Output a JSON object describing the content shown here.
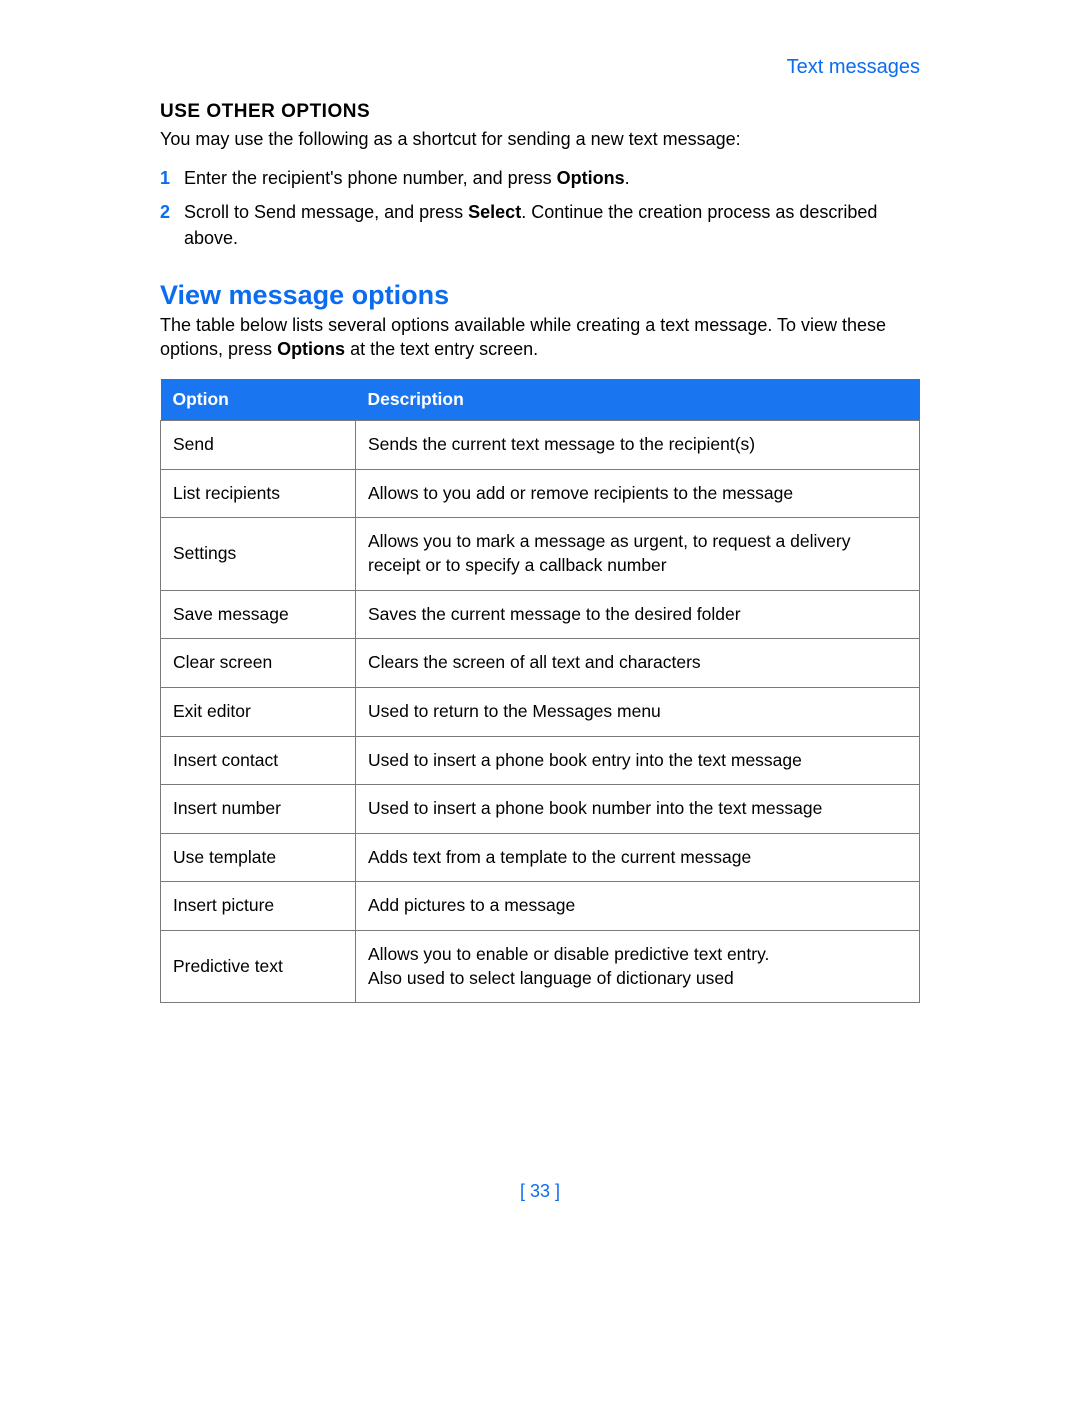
{
  "header": {
    "breadcrumb": "Text messages"
  },
  "use_other_options": {
    "heading": "USE OTHER OPTIONS",
    "intro": "You may use the following as a shortcut for sending a new text message:",
    "steps": [
      {
        "num": "1",
        "text_before": "Enter the recipient's phone number, and press ",
        "bold": "Options",
        "text_after": "."
      },
      {
        "num": "2",
        "text_before": "Scroll to Send message, and press ",
        "bold": "Select",
        "text_after": ". Continue the creation process as described above."
      }
    ]
  },
  "view_options": {
    "heading": "View message options",
    "intro_before": "The table below lists several options available while creating a text message. To view these options, press ",
    "intro_bold": "Options",
    "intro_after": " at the text entry screen.",
    "table": {
      "headers": {
        "option": "Option",
        "description": "Description"
      },
      "rows": [
        {
          "option": "Send",
          "description": "Sends the current text message to the recipient(s)"
        },
        {
          "option": "List recipients",
          "description": "Allows to you add or remove recipients to the message"
        },
        {
          "option": "Settings",
          "description": "Allows you to mark a message as urgent, to request a delivery receipt or to specify a callback number"
        },
        {
          "option": "Save message",
          "description": "Saves the current message to the desired folder"
        },
        {
          "option": "Clear screen",
          "description": "Clears the screen of all text and characters"
        },
        {
          "option": "Exit editor",
          "description": "Used to return to the Messages menu"
        },
        {
          "option": "Insert contact",
          "description": "Used to insert a phone book entry into the text message"
        },
        {
          "option": "Insert number",
          "description": "Used to insert a phone book number into the text message"
        },
        {
          "option": "Use template",
          "description": "Adds text from a template to the current message"
        },
        {
          "option": "Insert picture",
          "description": "Add pictures to a message"
        },
        {
          "option": "Predictive text",
          "description": "Allows you to enable or disable predictive text entry.\nAlso used to select language of dictionary used"
        }
      ]
    }
  },
  "page_number": "[ 33 ]"
}
